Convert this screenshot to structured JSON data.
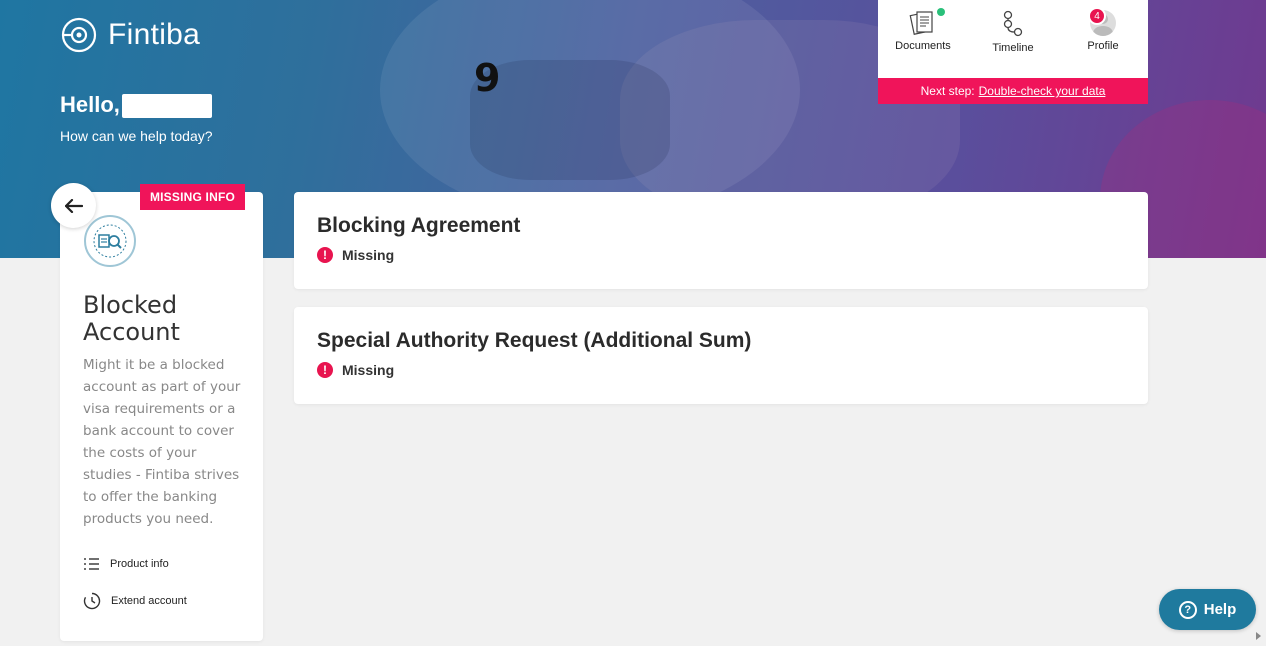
{
  "brand": {
    "name": "Fintiba"
  },
  "header": {
    "greeting": "Hello,",
    "subtitle": "How can we help today?",
    "overlay_number": "9"
  },
  "nav": {
    "items": [
      {
        "label": "Documents",
        "icon": "documents-icon",
        "has_dot": true
      },
      {
        "label": "Timeline",
        "icon": "timeline-icon"
      },
      {
        "label": "Profile",
        "icon": "profile-avatar",
        "badge": "4"
      }
    ],
    "next_step_prefix": "Next step:",
    "next_step_link": "Double-check your data"
  },
  "product": {
    "tag": "MISSING INFO",
    "title": "Blocked Account",
    "description": "Might it be a blocked account as part of your visa requirements or a bank account to cover the costs of your studies - Fintiba strives to offer the banking products you need.",
    "links": [
      {
        "label": "Product info",
        "icon": "list-icon"
      },
      {
        "label": "Extend account",
        "icon": "clock-icon"
      }
    ]
  },
  "documents": [
    {
      "title": "Blocking Agreement",
      "status": "Missing"
    },
    {
      "title": "Special Authority Request (Additional Sum)",
      "status": "Missing"
    }
  ],
  "help": {
    "label": "Help"
  },
  "colors": {
    "accent_pink": "#f0145a",
    "help_teal": "#1f7a9e",
    "status_green": "#2ac07a"
  }
}
